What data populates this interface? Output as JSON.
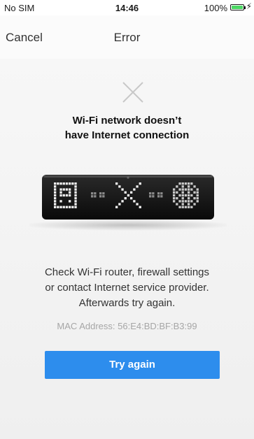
{
  "status_bar": {
    "carrier": "No SIM",
    "time": "14:46",
    "battery": "100%",
    "battery_icon": "battery-full-icon",
    "charging_icon": "charging-bolt-icon",
    "battery_color": "#4cd964"
  },
  "nav": {
    "cancel_label": "Cancel",
    "title": "Error"
  },
  "error": {
    "icon": "close-icon",
    "heading_line1": "Wi-Fi network doesn’t",
    "heading_line2": "have Internet connection",
    "device_image": "lametric-device-no-internet",
    "message_line1": "Check Wi-Fi router, firewall settings",
    "message_line2": "or contact Internet service provider.",
    "message_line3": "Afterwards try again.",
    "mac_address": "MAC Address: 56:E4:BD:BF:B3:99",
    "button_label": "Try again",
    "button_color": "#2d8ded"
  }
}
